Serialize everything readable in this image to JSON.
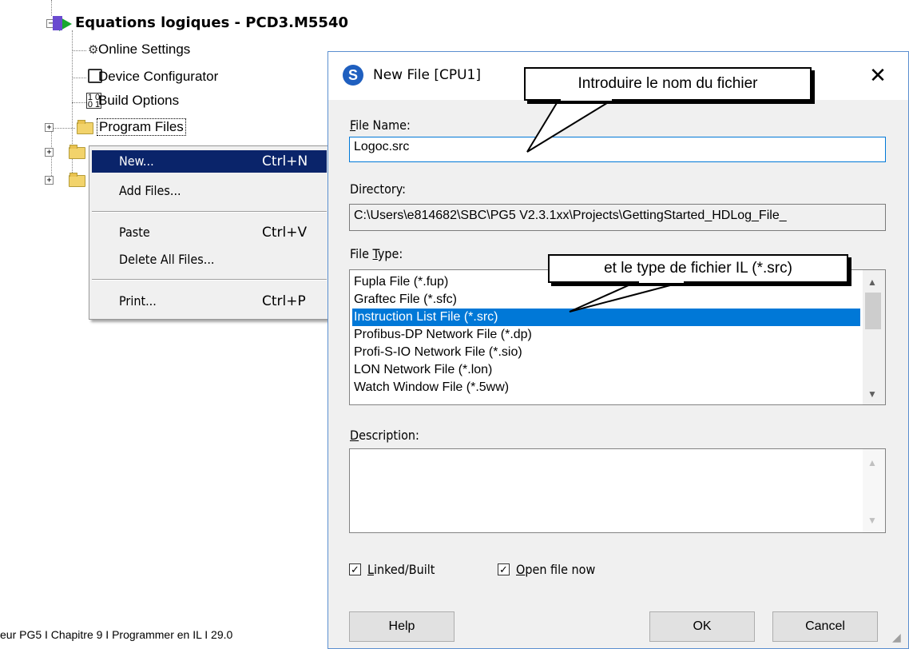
{
  "tree": {
    "root_title": "Equations logiques - PCD3.M5540",
    "items": [
      {
        "label": "Online Settings",
        "icon": "online-settings-icon"
      },
      {
        "label": "Device Configurator",
        "icon": "device-configurator-icon"
      },
      {
        "label": "Build Options",
        "icon": "build-options-icon"
      },
      {
        "label": "Program Files",
        "icon": "folder-icon"
      }
    ],
    "expander_plus": "+",
    "expander_minus": "−"
  },
  "context_menu": {
    "items": [
      {
        "label": "New...",
        "shortcut": "Ctrl+N",
        "highlighted": true
      },
      {
        "label": "Add Files...",
        "shortcut": ""
      },
      {
        "label": "Paste",
        "shortcut": "Ctrl+V"
      },
      {
        "label": "Delete All Files...",
        "shortcut": ""
      },
      {
        "label": "Print...",
        "shortcut": "Ctrl+P"
      }
    ]
  },
  "dialog": {
    "logo_glyph": "S",
    "title": "New File [CPU1]",
    "close_glyph": "✕",
    "file_name": {
      "label_key": "F",
      "label_rest": "ile Name:",
      "value": "Logoc.src"
    },
    "directory": {
      "label": "Directory:",
      "value": "C:\\Users\\e814682\\SBC\\PG5 V2.3.1xx\\Projects\\GettingStarted_HDLog_File_"
    },
    "file_type": {
      "label_pre": "File ",
      "label_key": "T",
      "label_rest": "ype:",
      "options": [
        "Fupla File (*.fup)",
        "Graftec File (*.sfc)",
        "Instruction List File (*.src)",
        "Profibus-DP Network File (*.dp)",
        "Profi-S-IO Network File (*.sio)",
        "LON Network File (*.lon)",
        "Watch Window File (*.5ww)"
      ],
      "selected_index": 2
    },
    "description": {
      "label_key": "D",
      "label_rest": "escription:",
      "value": ""
    },
    "linked_built": {
      "label_key": "L",
      "label_rest": "inked/Built",
      "checked": true
    },
    "open_file_now": {
      "label_key": "O",
      "label_rest": "pen file now",
      "checked": true
    },
    "buttons": {
      "help": "Help",
      "ok": "OK",
      "cancel": "Cancel"
    },
    "check_glyph": "✓",
    "scroll_up": "▲",
    "scroll_down": "▼"
  },
  "callouts": {
    "file_name_hint": "Introduire le nom du fichier",
    "file_type_hint": "et le type de fichier IL (*.src)"
  },
  "footer": {
    "text": "eur PG5 I Chapitre 9  I  Programmer en  IL  I  29.0"
  },
  "colors": {
    "menu_highlight": "#0a246a",
    "list_selection": "#0078d7",
    "dialog_border": "#5b8fd0"
  }
}
